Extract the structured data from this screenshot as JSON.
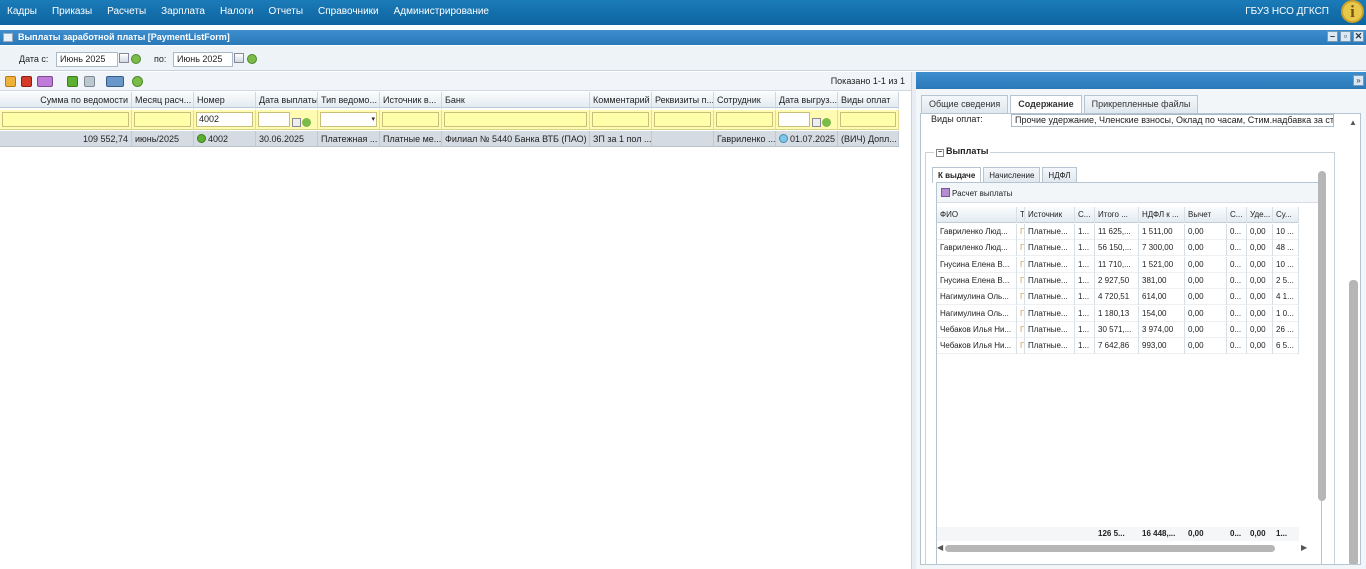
{
  "topbar": {
    "menu": [
      "Кадры",
      "Приказы",
      "Расчеты",
      "Зарплата",
      "Налоги",
      "Отчеты",
      "Справочники",
      "Администрирование"
    ],
    "org": "ГБУЗ НСО ДГКСП",
    "info_icon": "i"
  },
  "window": {
    "title": "Выплаты заработной платы [PaymentListForm]",
    "btn_min": "–",
    "btn_restore": "▫",
    "btn_close": "✕"
  },
  "dates": {
    "from_label": "Дата с:",
    "from_value": "Июнь 2025",
    "to_label": "по:",
    "to_value": "Июнь 2025"
  },
  "toolbar": {
    "shown": "Показано 1-1 из 1"
  },
  "grid": {
    "headers": [
      "Сумма по ведомости",
      "Месяц расч...",
      "Номер",
      "Дата выплаты",
      "Тип ведомо...",
      "Источник в...",
      "Банк",
      "Комментарий",
      "Реквизиты п...",
      "Сотрудник",
      "Дата выгруз...",
      "Виды оплат"
    ],
    "filter_number": "4002",
    "row": {
      "sum": "109 552,74",
      "month": "июнь/2025",
      "number": "4002",
      "pay_date": "30.06.2025",
      "type": "Платежная ...",
      "source": "Платные ме...",
      "bank": "Филиал № 5440 Банка ВТБ (ПАО)",
      "comment": "ЗП за 1 пол ...",
      "requisites": "",
      "employee": "Гавриленко ...",
      "upload_date": "01.07.2025",
      "pay_kinds": "(ВИЧ) Допл..."
    }
  },
  "right": {
    "tabs": [
      "Общие сведения",
      "Содержание",
      "Прикрепленные файлы"
    ],
    "active_tab": 1,
    "vidy_label": "Виды оплат:",
    "vidy_value": "Прочие удержание, Членские взносы, Оклад по часам, Стим.надбавка за ста",
    "section_title": "Выплаты",
    "inner_tabs": [
      "К выдаче",
      "Начисление",
      "НДФЛ"
    ],
    "calc_button": "Расчет выплаты",
    "columns": [
      "ФИО",
      "Т",
      "Источник",
      "С...",
      "Итого ...",
      "НДФЛ к ...",
      "Вычет",
      "С...",
      "Уде...",
      "Су..."
    ],
    "rows": [
      [
        "Гавриленко Люд...",
        "П",
        "Платные...",
        "1...",
        "11 625,...",
        "1 511,00",
        "0,00",
        "0...",
        "0,00",
        "10 ..."
      ],
      [
        "Гавриленко Люд...",
        "П",
        "Платные...",
        "1...",
        "56 150,...",
        "7 300,00",
        "0,00",
        "0...",
        "0,00",
        "48 ..."
      ],
      [
        "Гнусина Елена В...",
        "П",
        "Платные...",
        "1...",
        "11 710,...",
        "1 521,00",
        "0,00",
        "0...",
        "0,00",
        "10 ..."
      ],
      [
        "Гнусина Елена В...",
        "П",
        "Платные...",
        "1...",
        "2 927,50",
        "381,00",
        "0,00",
        "0...",
        "0,00",
        "2 5..."
      ],
      [
        "Нагимулина Оль...",
        "П",
        "Платные...",
        "1...",
        "4 720,51",
        "614,00",
        "0,00",
        "0...",
        "0,00",
        "4 1..."
      ],
      [
        "Нагимулина Оль...",
        "П",
        "Платные...",
        "1...",
        "1 180,13",
        "154,00",
        "0,00",
        "0...",
        "0,00",
        "1 0..."
      ],
      [
        "Чебаков Илья Ни...",
        "П",
        "Платные...",
        "1...",
        "30 571,...",
        "3 974,00",
        "0,00",
        "0...",
        "0,00",
        "26 ..."
      ],
      [
        "Чебаков Илья Ни...",
        "П",
        "Платные...",
        "1...",
        "7 642,86",
        "993,00",
        "0,00",
        "0...",
        "0,00",
        "6 5..."
      ]
    ],
    "totals": [
      "126 5...",
      "16 448,...",
      "0,00",
      "0...",
      "0,00",
      "1..."
    ]
  },
  "colors": {
    "menu_bar": "#0d64a0",
    "title_bar": "#2a78b8",
    "filter_bg": "#fffbb0",
    "selected_row": "#d4dbe2"
  }
}
